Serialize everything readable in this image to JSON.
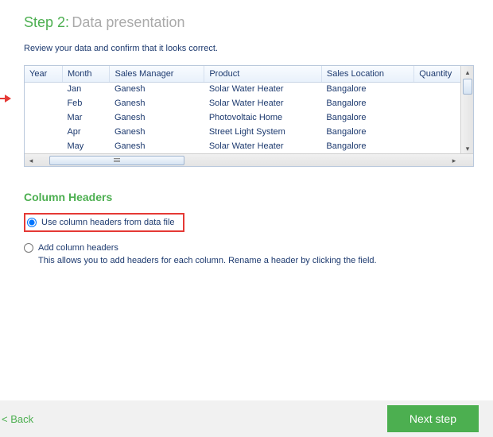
{
  "header": {
    "step_label": "Step 2:",
    "heading": "Data presentation",
    "instruction": "Review your data and confirm that it looks correct."
  },
  "table": {
    "columns": [
      "Year",
      "Month",
      "Sales Manager",
      "Product",
      "Sales Location",
      "Quantity"
    ],
    "rows": [
      [
        "",
        "Jan",
        "Ganesh",
        "Solar Water Heater",
        "Bangalore",
        ""
      ],
      [
        "",
        "Feb",
        "Ganesh",
        "Solar Water Heater",
        "Bangalore",
        ""
      ],
      [
        "",
        "Mar",
        "Ganesh",
        "Photovoltaic Home",
        "Bangalore",
        ""
      ],
      [
        "",
        "Apr",
        "Ganesh",
        "Street Light System",
        "Bangalore",
        ""
      ],
      [
        "",
        "May",
        "Ganesh",
        "Solar Water Heater",
        "Bangalore",
        ""
      ]
    ]
  },
  "column_headers": {
    "title": "Column Headers",
    "option_use_file": "Use column headers from data file",
    "option_add": "Add column headers",
    "add_help": "This allows you to add headers for each column. Rename a header by clicking the field."
  },
  "footer": {
    "back": "< Back",
    "next": "Next step"
  }
}
